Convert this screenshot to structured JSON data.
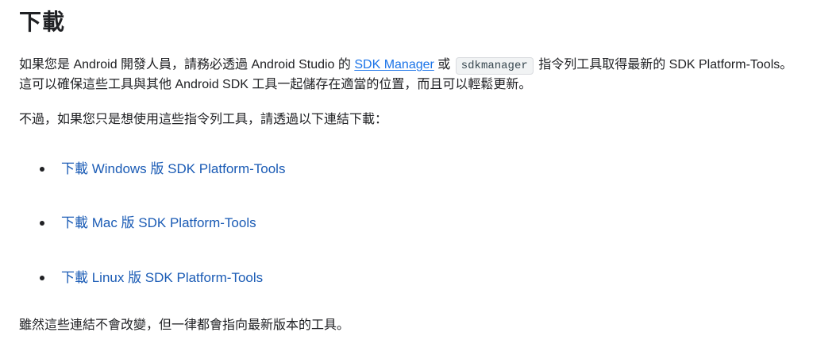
{
  "section": {
    "heading": "下載"
  },
  "intro": {
    "text_before_link": "如果您是 Android 開發人員，請務必透過 Android Studio 的 ",
    "sdk_manager_link": "SDK Manager",
    "text_between": " 或 ",
    "sdkmanager_code": "sdkmanager",
    "text_after_code": " 指令列工具取得最新的 SDK Platform-Tools。這可以確保這些工具與其他 Android SDK 工具一起儲存在適當的位置，而且可以輕鬆更新。"
  },
  "note": {
    "text": "不過，如果您只是想使用這些指令列工具，請透過以下連結下載："
  },
  "downloads": [
    {
      "label": "下載 Windows 版 SDK Platform-Tools"
    },
    {
      "label": "下載 Mac 版 SDK Platform-Tools"
    },
    {
      "label": "下載 Linux 版 SDK Platform-Tools"
    }
  ],
  "footer_note": {
    "text": "雖然這些連結不會改變，但一律都會指向最新版本的工具。"
  },
  "colors": {
    "link": "#1a73e8",
    "download_link": "#1a5bb5",
    "text": "#202124",
    "code_bg": "#f1f3f4"
  }
}
